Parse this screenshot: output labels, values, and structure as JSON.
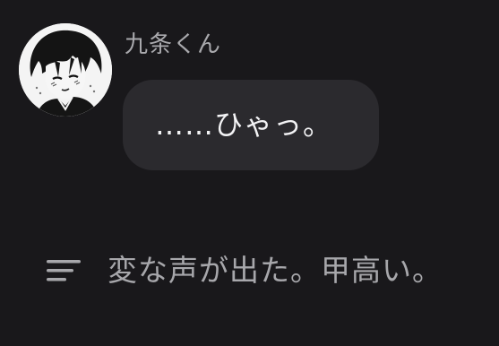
{
  "message": {
    "sender": "九条くん",
    "text": "……ひゃっ。",
    "avatar_icon": "manga-boy-avatar"
  },
  "narration": {
    "icon": "narration-lines-icon",
    "text": "変な声が出た。甲高い。"
  },
  "colors": {
    "background": "#19181b",
    "bubble": "#2b2a2e",
    "bubble_text": "#f3f3f5",
    "muted_text": "#a7a7ab"
  }
}
